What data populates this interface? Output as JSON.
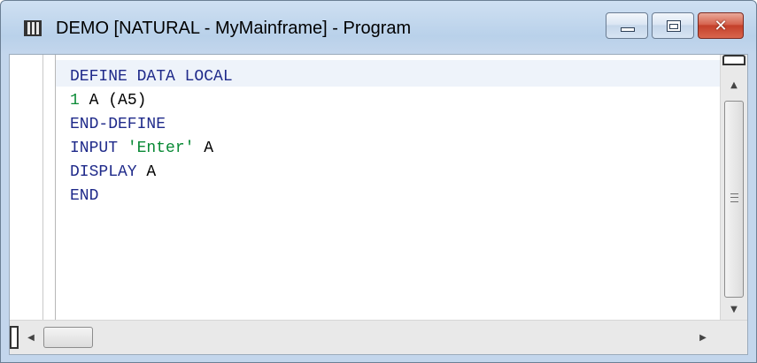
{
  "window": {
    "title": "DEMO [NATURAL - MyMainframe] - Program",
    "icon": "program-editor-icon"
  },
  "caption_buttons": {
    "minimize_icon": "minimize-icon",
    "maximize_icon": "maximize-icon",
    "close_icon": "close-icon",
    "close_glyph": "✕"
  },
  "colors": {
    "keyword": "#1f2a8a",
    "literal": "#0a8a36",
    "plain": "#000000",
    "close_button": "#c4402a"
  },
  "editor": {
    "lines": [
      {
        "tokens": [
          {
            "text": "DEFINE DATA LOCAL",
            "type": "kw"
          }
        ]
      },
      {
        "tokens": [
          {
            "text": "1",
            "type": "num"
          },
          {
            "text": " A (A5)",
            "type": "plain"
          }
        ]
      },
      {
        "tokens": [
          {
            "text": "END-DEFINE",
            "type": "kw"
          }
        ]
      },
      {
        "tokens": [
          {
            "text": "INPUT ",
            "type": "kw"
          },
          {
            "text": "'Enter'",
            "type": "str"
          },
          {
            "text": " A",
            "type": "plain"
          }
        ]
      },
      {
        "tokens": [
          {
            "text": "DISPLAY ",
            "type": "kw"
          },
          {
            "text": "A",
            "type": "plain"
          }
        ]
      },
      {
        "tokens": [
          {
            "text": "END",
            "type": "kw"
          }
        ]
      }
    ]
  },
  "scrollbars": {
    "up_arrow": "▲",
    "down_arrow": "▼",
    "left_arrow": "◀",
    "right_arrow": "▶"
  }
}
